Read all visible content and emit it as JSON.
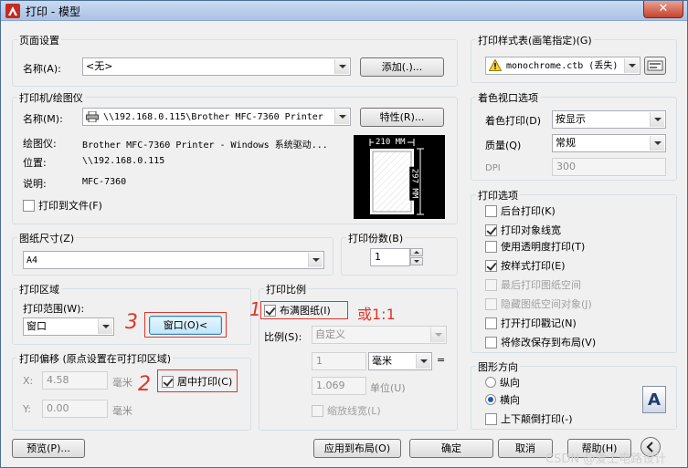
{
  "window": {
    "title": "打印 - 模型",
    "close": "✕"
  },
  "page_setup": {
    "group": "页面设置",
    "name_label": "名称(A):",
    "name_value": "<无>",
    "add_button": "添加(.)..."
  },
  "printer": {
    "group": "打印机/绘图仪",
    "name_label": "名称(M):",
    "name_value": "\\\\192.168.0.115\\Brother MFC-7360 Printer",
    "properties_button": "特性(R)...",
    "plotter_label": "绘图仪:",
    "plotter_value": "Brother MFC-7360 Printer - Windows 系统驱动...",
    "location_label": "位置:",
    "location_value": "\\\\192.168.0.115",
    "description_label": "说明:",
    "description_value": "MFC-7360",
    "print_to_file": "打印到文件(F)",
    "preview_width": "210 MM",
    "preview_height": "297 MM"
  },
  "paper_size": {
    "group": "图纸尺寸(Z)",
    "value": "A4"
  },
  "copies": {
    "group": "打印份数(B)",
    "value": "1"
  },
  "plot_area": {
    "group": "打印区域",
    "range_label": "打印范围(W):",
    "range_value": "窗口",
    "window_button": "窗口(O)<"
  },
  "plot_offset": {
    "group": "打印偏移 (原点设置在可打印区域)",
    "x_label": "X:",
    "x_value": "4.58",
    "x_unit": "毫米",
    "y_label": "Y:",
    "y_value": "0.00",
    "y_unit": "毫米",
    "center": "居中打印(C)"
  },
  "plot_scale": {
    "group": "打印比例",
    "fit": "布满图纸(I)",
    "scale_label": "比例(S):",
    "scale_value": "自定义",
    "num_value": "1",
    "unit_value": "毫米",
    "equals": "=",
    "den_value": "1.069",
    "den_unit": "单位(U)",
    "lineweights": "缩放线宽(L)"
  },
  "annotations": {
    "one": "1",
    "two": "2",
    "three": "3",
    "ratio": "或1:1"
  },
  "style_table": {
    "group": "打印样式表(画笔指定)(G)",
    "value": "monochrome.ctb (丢失)"
  },
  "shaded": {
    "group": "着色视口选项",
    "shade_label": "着色打印(D)",
    "shade_value": "按显示",
    "quality_label": "质量(Q)",
    "quality_value": "常规",
    "dpi_label": "DPI",
    "dpi_value": "300"
  },
  "options": {
    "group": "打印选项",
    "items": [
      {
        "label": "后台打印(K)"
      },
      {
        "label": "打印对象线宽"
      },
      {
        "label": "使用透明度打印(T)"
      },
      {
        "label": "按样式打印(E)"
      },
      {
        "label": "最后打印图纸空间"
      },
      {
        "label": "隐藏图纸空间对象(J)"
      },
      {
        "label": "打开打印戳记(N)"
      },
      {
        "label": "将修改保存到布局(V)"
      }
    ]
  },
  "orientation": {
    "group": "图形方向",
    "portrait": "纵向",
    "landscape": "横向",
    "upside_down": "上下颠倒打印(-)",
    "icon_letter": "A"
  },
  "buttons": {
    "preview": "预览(P)...",
    "apply": "应用到布局(O)",
    "ok": "确定",
    "cancel": "取消",
    "help": "帮助(H)"
  },
  "watermark": "CSDN @爱上电路设计"
}
